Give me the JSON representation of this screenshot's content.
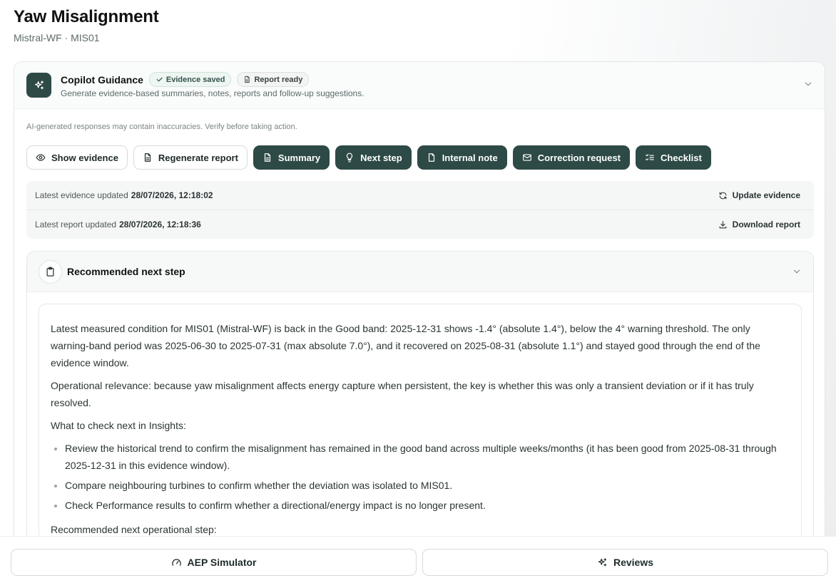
{
  "header": {
    "title": "Yaw Misalignment",
    "subtitle": "Mistral-WF · MIS01"
  },
  "copilot": {
    "title": "Copilot Guidance",
    "badge_evidence": "Evidence saved",
    "badge_report": "Report ready",
    "description": "Generate evidence-based summaries, notes, reports and follow-up suggestions.",
    "disclaimer": "AI-generated responses may contain inaccuracies. Verify before taking action.",
    "buttons": {
      "show_evidence": "Show evidence",
      "regenerate_report": "Regenerate report",
      "summary": "Summary",
      "next_step": "Next step",
      "internal_note": "Internal note",
      "correction_request": "Correction request",
      "checklist": "Checklist"
    },
    "meta": {
      "evidence_label": "Latest evidence updated",
      "evidence_time": "28/07/2026, 12:18:02",
      "evidence_action": "Update evidence",
      "report_label": "Latest report updated",
      "report_time": "28/07/2026, 12:18:36",
      "report_action": "Download report"
    }
  },
  "next_step": {
    "title": "Recommended next step",
    "paragraphs": [
      "Latest measured condition for MIS01 (Mistral-WF) is back in the Good band: 2025-12-31 shows -1.4° (absolute 1.4°), below the 4° warning threshold. The only warning-band period was 2025-06-30 to 2025-07-31 (max absolute 7.0°), and it recovered on 2025-08-31 (absolute 1.1°) and stayed good through the end of the evidence window.",
      "Operational relevance: because yaw misalignment affects energy capture when persistent, the key is whether this was only a transient deviation or if it has truly resolved.",
      "What to check next in Insights:"
    ],
    "bullets": [
      "Review the historical trend to confirm the misalignment has remained in the good band across multiple weeks/months (it has been good from 2025-08-31 through 2025-12-31 in this evidence window).",
      "Compare neighbouring turbines to confirm whether the deviation was isolated to MIS01.",
      "Check Performance results to confirm whether a directional/energy impact is no longer present."
    ],
    "closing": "Recommended next operational step:"
  },
  "bottom": {
    "aep_simulator": "AEP Simulator",
    "reviews": "Reviews"
  },
  "colors": {
    "accent": "#2d4a46",
    "accent_text": "#ffffff"
  }
}
